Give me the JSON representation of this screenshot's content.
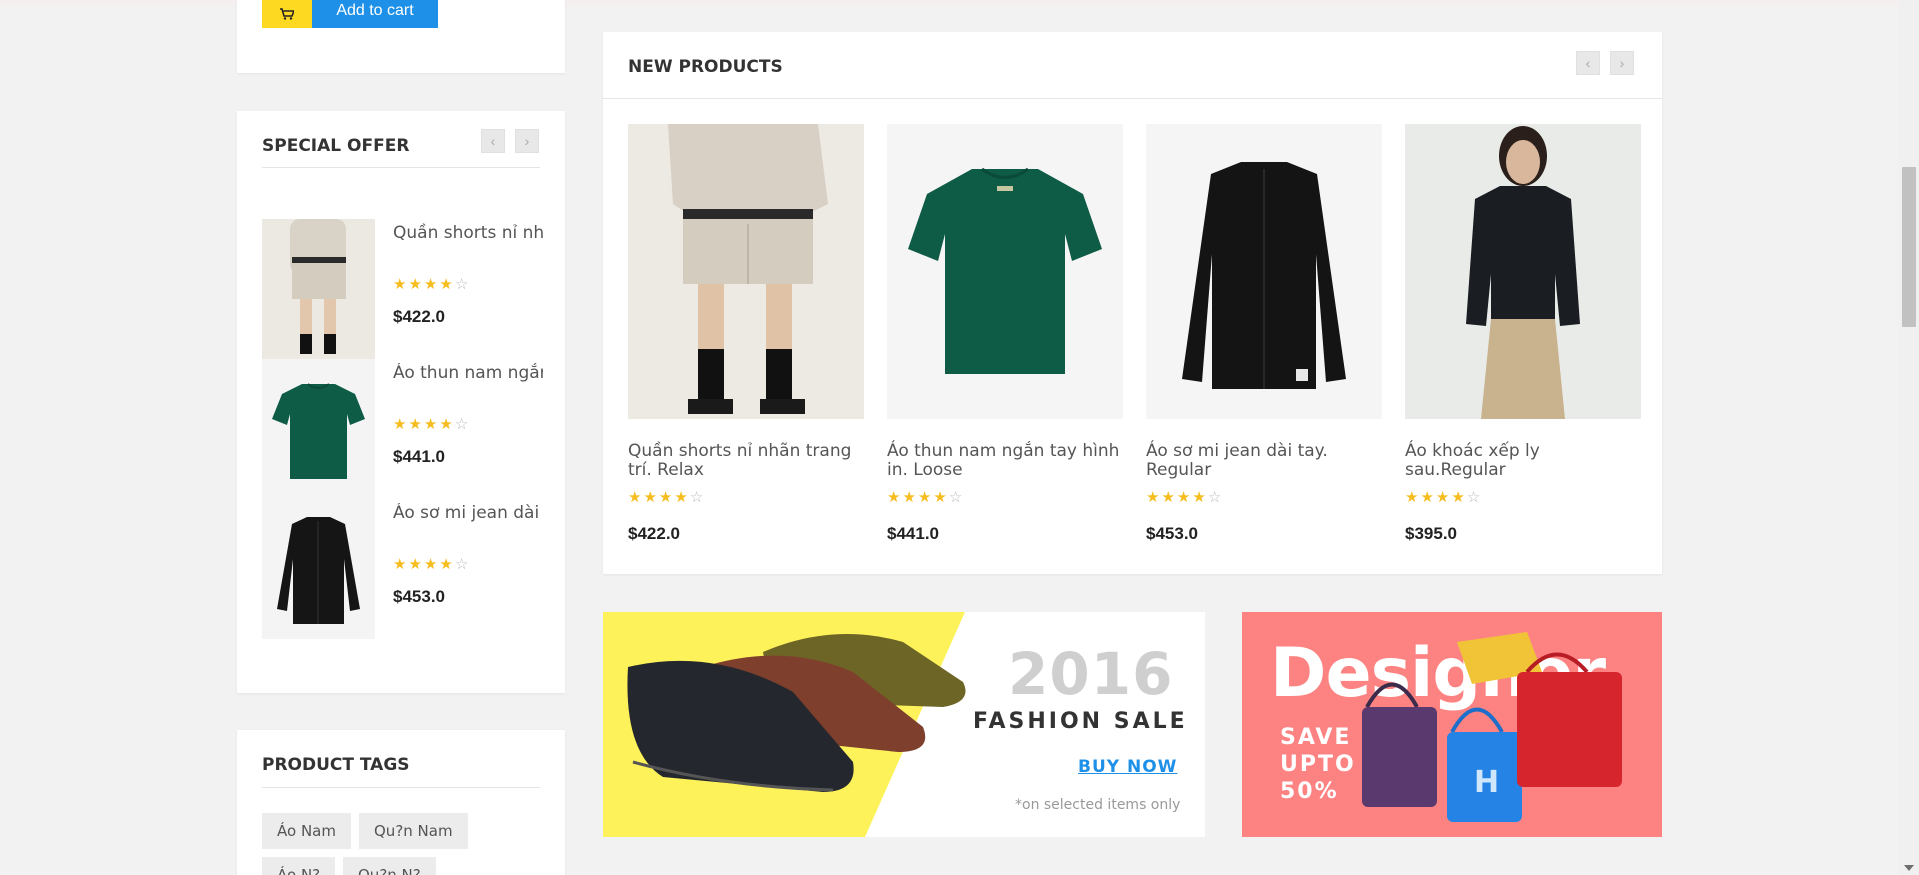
{
  "cart": {
    "button_label": "Add to cart"
  },
  "special_offer": {
    "title": "SPECIAL OFFER",
    "items": [
      {
        "title": "Quần shorts nỉ nhãn trang trí. Relax",
        "rating": 4,
        "price": "$422.0"
      },
      {
        "title": "Áo thun nam ngắn tay hình in. Loose",
        "rating": 4,
        "price": "$441.0"
      },
      {
        "title": "Áo sơ mi jean dài tay. Regular",
        "rating": 4,
        "price": "$453.0"
      }
    ]
  },
  "product_tags": {
    "title": "PRODUCT TAGS",
    "tags": [
      "Áo Nam",
      "Qu?n Nam",
      "Áo N?",
      "Qu?n N?"
    ]
  },
  "new_products": {
    "title": "NEW PRODUCTS",
    "items": [
      {
        "title": "Quần shorts nỉ nhãn trang trí. Relax",
        "rating": 4,
        "price": "$422.0"
      },
      {
        "title": "Áo thun nam ngắn tay hình in. Loose",
        "rating": 4,
        "price": "$441.0"
      },
      {
        "title": "Áo sơ mi jean dài tay. Regular",
        "rating": 4,
        "price": "$453.0"
      },
      {
        "title": "Áo khoác xếp ly sau.Regular",
        "rating": 4,
        "price": "$395.0"
      }
    ]
  },
  "banners": {
    "left": {
      "year": "2016",
      "headline": "FASHION SALE",
      "cta": "BUY NOW",
      "note": "*on selected items only"
    },
    "right": {
      "headline": "Designer",
      "promo_line1": "SAVE",
      "promo_line2": "UPTO",
      "promo_line3": "50%"
    }
  },
  "colors": {
    "accent_blue": "#1e90e8",
    "accent_yellow": "#fdd922",
    "star": "#f5bd1f",
    "banner_pink": "#fd8383",
    "banner_yellow": "#fdf25a"
  }
}
